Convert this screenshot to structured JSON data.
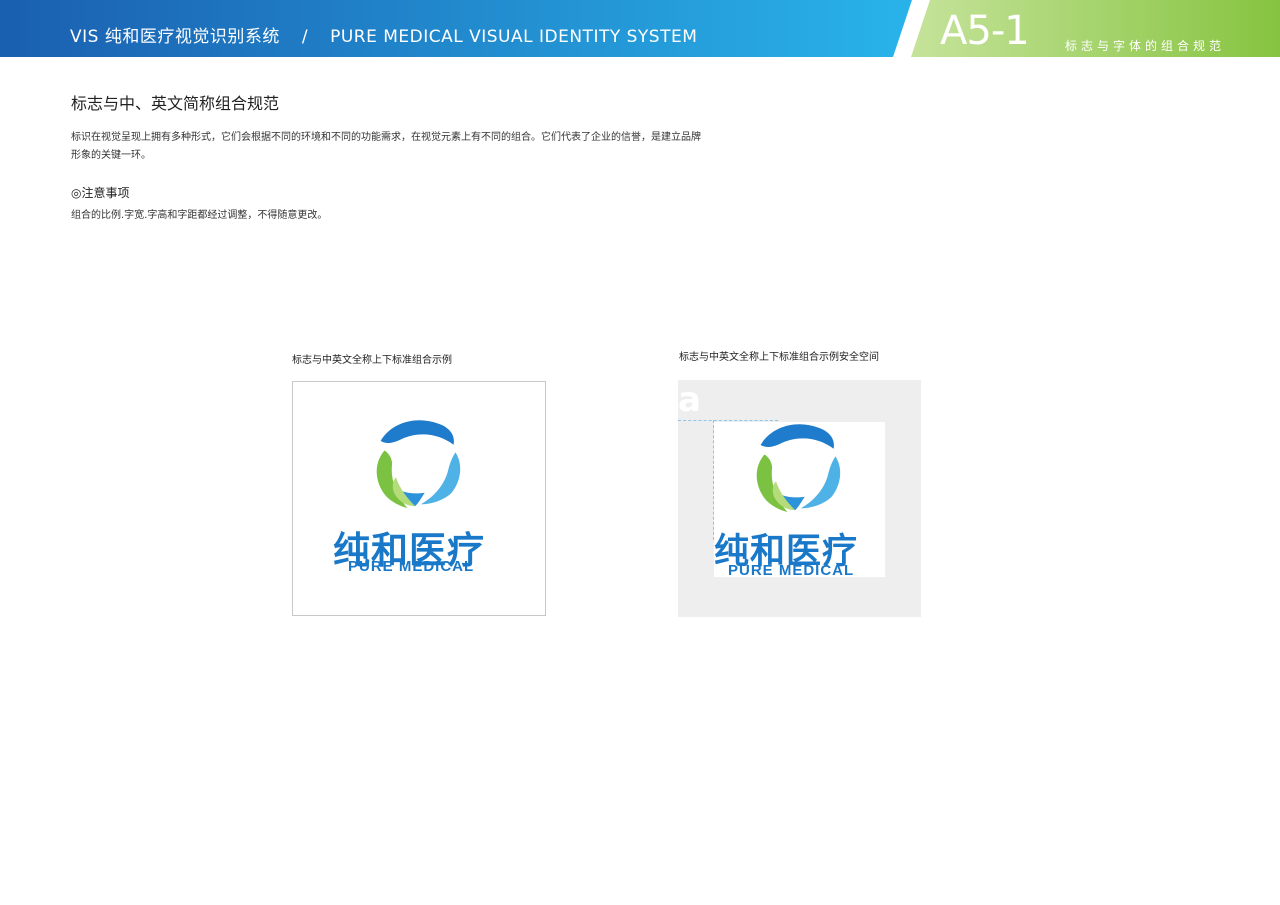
{
  "header": {
    "title_cn": "VIS  纯和医疗视觉识别系统",
    "separator": "/",
    "title_en": "PURE MEDICAL VISUAL IDENTITY SYSTEM",
    "code": "A5-1",
    "code_sub": "标志与字体的组合规范",
    "colors": {
      "blue_start": "#1a64b4",
      "blue_end": "#2ab0e8",
      "green_start": "#b5d97e",
      "green_end": "#8cc63f"
    }
  },
  "section": {
    "title": "标志与中、英文简称组合规范",
    "description": "标识在视觉呈现上拥有多种形式，它们会根据不同的环境和不同的功能需求，在视觉元素上有不同的组合。它们代表了企业的信誉，是建立品牌形象的关键一环。",
    "note_title": "◎注意事项",
    "note_text": "组合的比例.字宽.字高和字距都经过调整，不得随意更改。"
  },
  "examples": [
    {
      "caption": "标志与中英文全称上下标准组合示例",
      "logo_cn": "纯和医疗",
      "logo_en": "PURE MEDICAL"
    },
    {
      "caption": "标志与中英文全称上下标准组合示例安全空间",
      "logo_cn": "纯和医疗",
      "logo_en": "PURE MEDICAL",
      "safe_space_marker": "a"
    }
  ],
  "logo_colors": {
    "blue": "#1a78c8",
    "light_blue": "#3fa9e0",
    "green": "#7cc242",
    "light_green": "#b5dc7a"
  }
}
